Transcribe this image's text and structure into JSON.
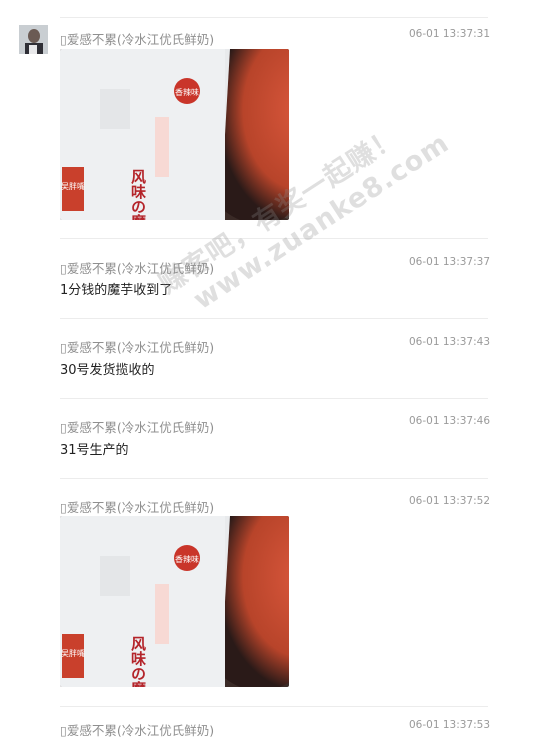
{
  "chat": {
    "messages": [
      {
        "sender": "爱感不累(冷水江优氏鲜奶)",
        "time": "06-01 13:37:31",
        "image": "konjac-package-photo"
      },
      {
        "sender": "爱感不累(冷水江优氏鲜奶)",
        "time": "06-01 13:37:37",
        "text": "1分钱的魔芋收到了"
      },
      {
        "sender": "爱感不累(冷水江优氏鲜奶)",
        "time": "06-01 13:37:43",
        "text": "30号发货揽收的"
      },
      {
        "sender": "爱感不累(冷水江优氏鲜奶)",
        "time": "06-01 13:37:46",
        "text": "31号生产的"
      },
      {
        "sender": "爱感不累(冷水江优氏鲜奶)",
        "time": "06-01 13:37:52",
        "image": "konjac-package-photo"
      },
      {
        "sender": "爱感不累(冷水江优氏鲜奶)",
        "time": "06-01 13:37:53"
      }
    ]
  },
  "product": {
    "brand": "吴胖嘴",
    "name": "风味の魔芋",
    "flavor": "香辣味"
  },
  "watermark": {
    "line1": "赚客吧，有奖一起赚！",
    "line2": "www.zuanke8.com"
  }
}
